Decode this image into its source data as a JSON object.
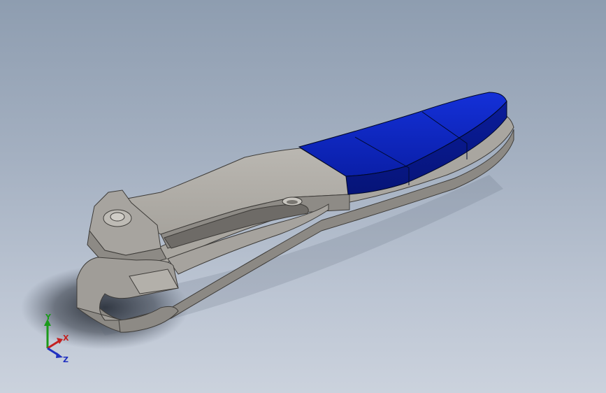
{
  "viewport": {
    "background_top": "#8e9db0",
    "background_bottom": "#cbd2dd"
  },
  "model": {
    "body_color": "#a09d98",
    "grip_color": "#0b23b2"
  },
  "triad": {
    "y_label": "Y",
    "x_label": "X",
    "z_label": "Z",
    "y_color": "#1a9a1a",
    "x_color": "#c42020",
    "z_color": "#2030c0"
  }
}
